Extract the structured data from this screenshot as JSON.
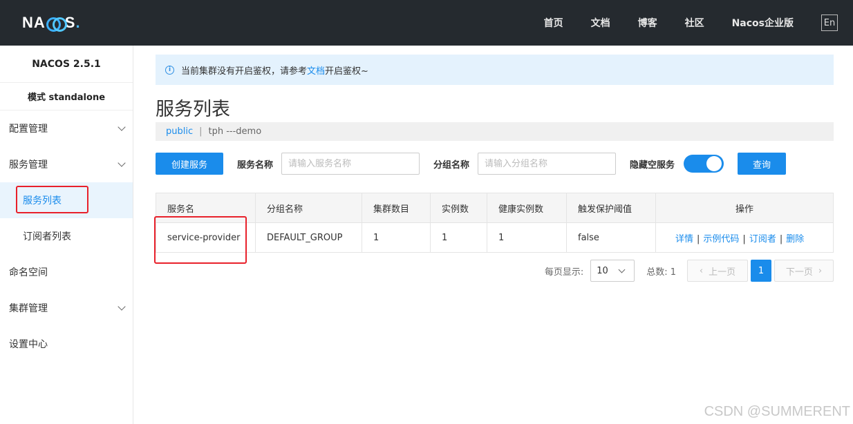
{
  "header": {
    "logo_text": "NACOS.",
    "nav": [
      "首页",
      "文档",
      "博客",
      "社区",
      "Nacos企业版"
    ],
    "lang_button": "En"
  },
  "sidebar": {
    "version": "NACOS 2.5.1",
    "mode": "模式 standalone",
    "items": [
      {
        "label": "配置管理",
        "expandable": true
      },
      {
        "label": "服务管理",
        "expandable": true
      },
      {
        "label": "服务列表",
        "active": true,
        "sub": true
      },
      {
        "label": "订阅者列表",
        "sub": true
      },
      {
        "label": "命名空间"
      },
      {
        "label": "集群管理",
        "expandable": true
      },
      {
        "label": "设置中心"
      }
    ]
  },
  "notice": {
    "icon": "info-icon",
    "text_before": "当前集群没有开启鉴权，请参考",
    "link_text": "文档",
    "text_after": "开启鉴权~"
  },
  "page_title": "服务列表",
  "namespaces": {
    "active": "public",
    "other": "tph ---demo"
  },
  "toolbar": {
    "create_label": "创建服务",
    "service_name_label": "服务名称",
    "service_name_placeholder": "请输入服务名称",
    "group_name_label": "分组名称",
    "group_name_placeholder": "请输入分组名称",
    "hide_empty_label": "隐藏空服务",
    "hide_empty_on": true,
    "query_label": "查询"
  },
  "table": {
    "columns": [
      "服务名",
      "分组名称",
      "集群数目",
      "实例数",
      "健康实例数",
      "触发保护阈值",
      "操作"
    ],
    "rows": [
      {
        "service": "service-provider",
        "group": "DEFAULT_GROUP",
        "clusters": "1",
        "instances": "1",
        "healthy": "1",
        "protect": "false",
        "ops": [
          "详情",
          "示例代码",
          "订阅者",
          "删除"
        ]
      }
    ]
  },
  "pagination": {
    "page_size_label": "每页显示:",
    "page_size": "10",
    "total_label": "总数: 1",
    "prev_label": "上一页",
    "current_page": "1",
    "next_label": "下一页"
  },
  "watermark": "CSDN @SUMMERENT",
  "colors": {
    "header_bg": "#252a2f",
    "accent": "#1a8ceb",
    "annotation": "#e8202a"
  }
}
